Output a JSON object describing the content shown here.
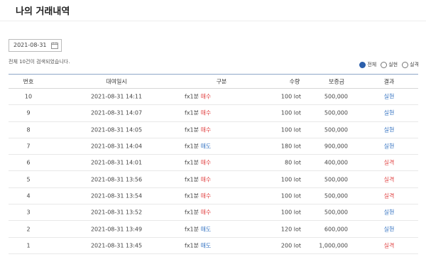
{
  "page": {
    "title": "나의 거래내역"
  },
  "search": {
    "date": "2021-08-31",
    "result_count": "전체 10건이 검색되었습니다."
  },
  "filters": [
    {
      "label": "전체",
      "checked": true
    },
    {
      "label": "실현",
      "checked": false
    },
    {
      "label": "실격",
      "checked": false
    }
  ],
  "table": {
    "headers": {
      "no": "번호",
      "date": "대여일시",
      "type": "구분",
      "qty": "수량",
      "margin": "보증금",
      "result": "결과"
    },
    "rows": [
      {
        "no": "10",
        "date": "2021-08-31 14:11",
        "product": "fx1분",
        "side": "매수",
        "qty": "100 lot",
        "margin": "500,000",
        "result": "실현"
      },
      {
        "no": "9",
        "date": "2021-08-31 14:07",
        "product": "fx1분",
        "side": "매수",
        "qty": "100 lot",
        "margin": "500,000",
        "result": "실현"
      },
      {
        "no": "8",
        "date": "2021-08-31 14:05",
        "product": "fx1분",
        "side": "매수",
        "qty": "100 lot",
        "margin": "500,000",
        "result": "실현"
      },
      {
        "no": "7",
        "date": "2021-08-31 14:04",
        "product": "fx1분",
        "side": "매도",
        "qty": "180 lot",
        "margin": "900,000",
        "result": "실현"
      },
      {
        "no": "6",
        "date": "2021-08-31 14:01",
        "product": "fx1분",
        "side": "매수",
        "qty": "80 lot",
        "margin": "400,000",
        "result": "실격"
      },
      {
        "no": "5",
        "date": "2021-08-31 13:56",
        "product": "fx1분",
        "side": "매수",
        "qty": "100 lot",
        "margin": "500,000",
        "result": "실격"
      },
      {
        "no": "4",
        "date": "2021-08-31 13:54",
        "product": "fx1분",
        "side": "매수",
        "qty": "100 lot",
        "margin": "500,000",
        "result": "실격"
      },
      {
        "no": "3",
        "date": "2021-08-31 13:52",
        "product": "fx1분",
        "side": "매수",
        "qty": "100 lot",
        "margin": "500,000",
        "result": "실현"
      },
      {
        "no": "2",
        "date": "2021-08-31 13:49",
        "product": "fx1분",
        "side": "매도",
        "qty": "120 lot",
        "margin": "600,000",
        "result": "실현"
      },
      {
        "no": "1",
        "date": "2021-08-31 13:45",
        "product": "fx1분",
        "side": "매도",
        "qty": "200 lot",
        "margin": "1,000,000",
        "result": "실격"
      }
    ]
  },
  "colors": {
    "buy": "#e04040",
    "sell": "#3070c0",
    "win": "#3070c0",
    "lose": "#e04040",
    "accent": "#2b5fab"
  },
  "icons": {
    "date_picker": "calendar-icon"
  }
}
